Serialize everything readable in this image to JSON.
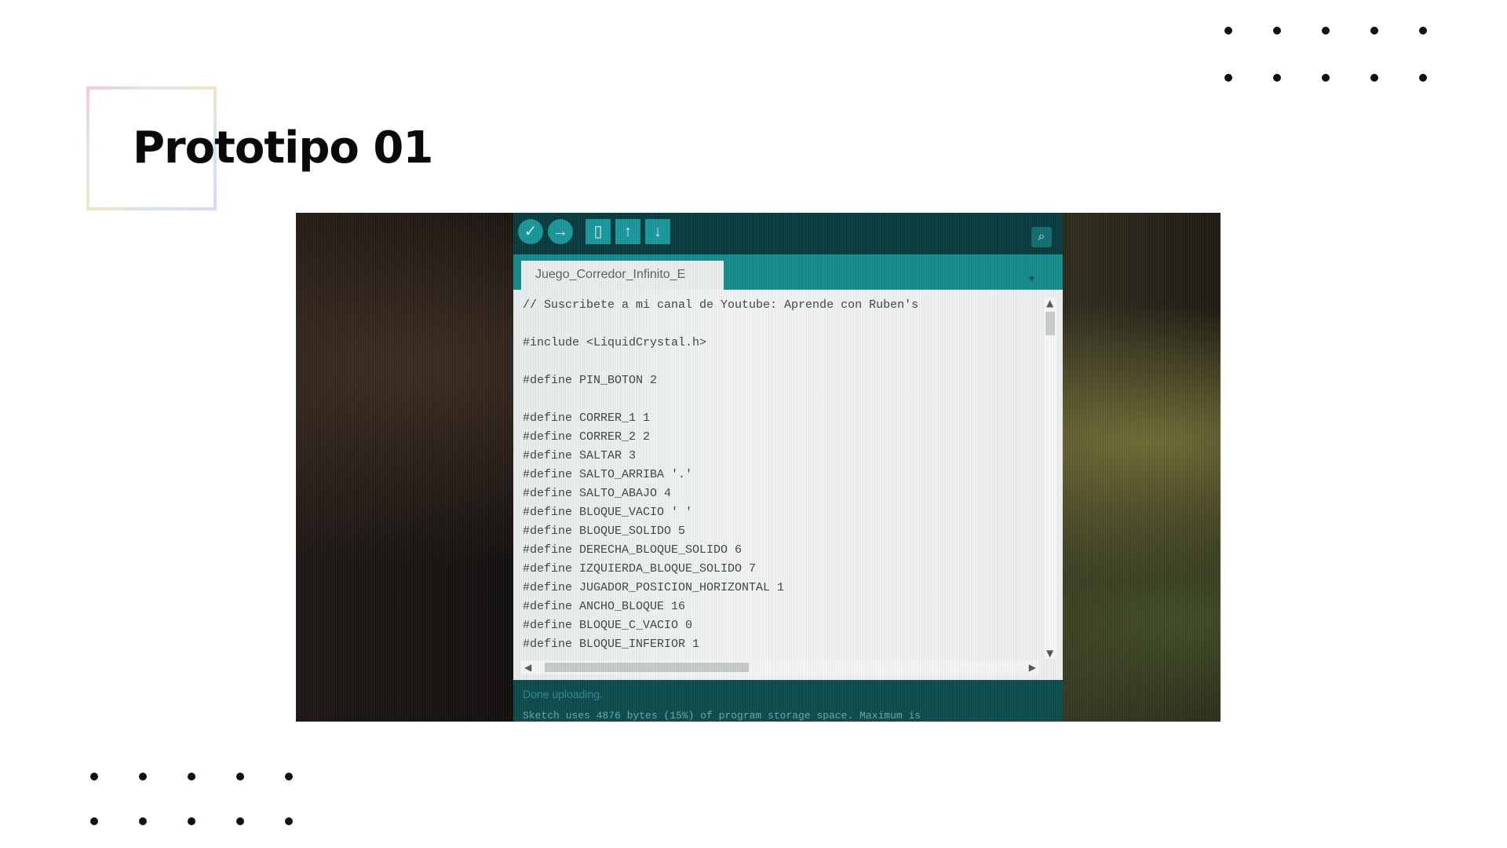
{
  "slide": {
    "title": "Prototipo 01"
  },
  "ide": {
    "toolbar_icons": [
      "verify-icon",
      "upload-icon",
      "new-icon",
      "open-icon",
      "save-icon",
      "serial-monitor-icon"
    ],
    "tab_label": "Juego_Corredor_Infinito_E",
    "code_lines": [
      "// Suscribete a mi canal de Youtube: Aprende con Ruben's",
      "",
      "#include <LiquidCrystal.h>",
      "",
      "#define PIN_BOTON 2",
      "",
      "#define CORRER_1 1",
      "#define CORRER_2 2",
      "#define SALTAR 3",
      "#define SALTO_ARRIBA '.'",
      "#define SALTO_ABAJO 4",
      "#define BLOQUE_VACIO ' '",
      "#define BLOQUE_SOLIDO 5",
      "#define DERECHA_BLOQUE_SOLIDO 6",
      "#define IZQUIERDA_BLOQUE_SOLIDO 7",
      "#define JUGADOR_POSICION_HORIZONTAL 1",
      "#define ANCHO_BLOQUE 16",
      "#define BLOQUE_C_VACIO 0",
      "#define BLOQUE_INFERIOR 1"
    ],
    "status": "Done uploading.",
    "console": "Sketch uses 4876 bytes (15%) of program storage space. Maximum is"
  }
}
